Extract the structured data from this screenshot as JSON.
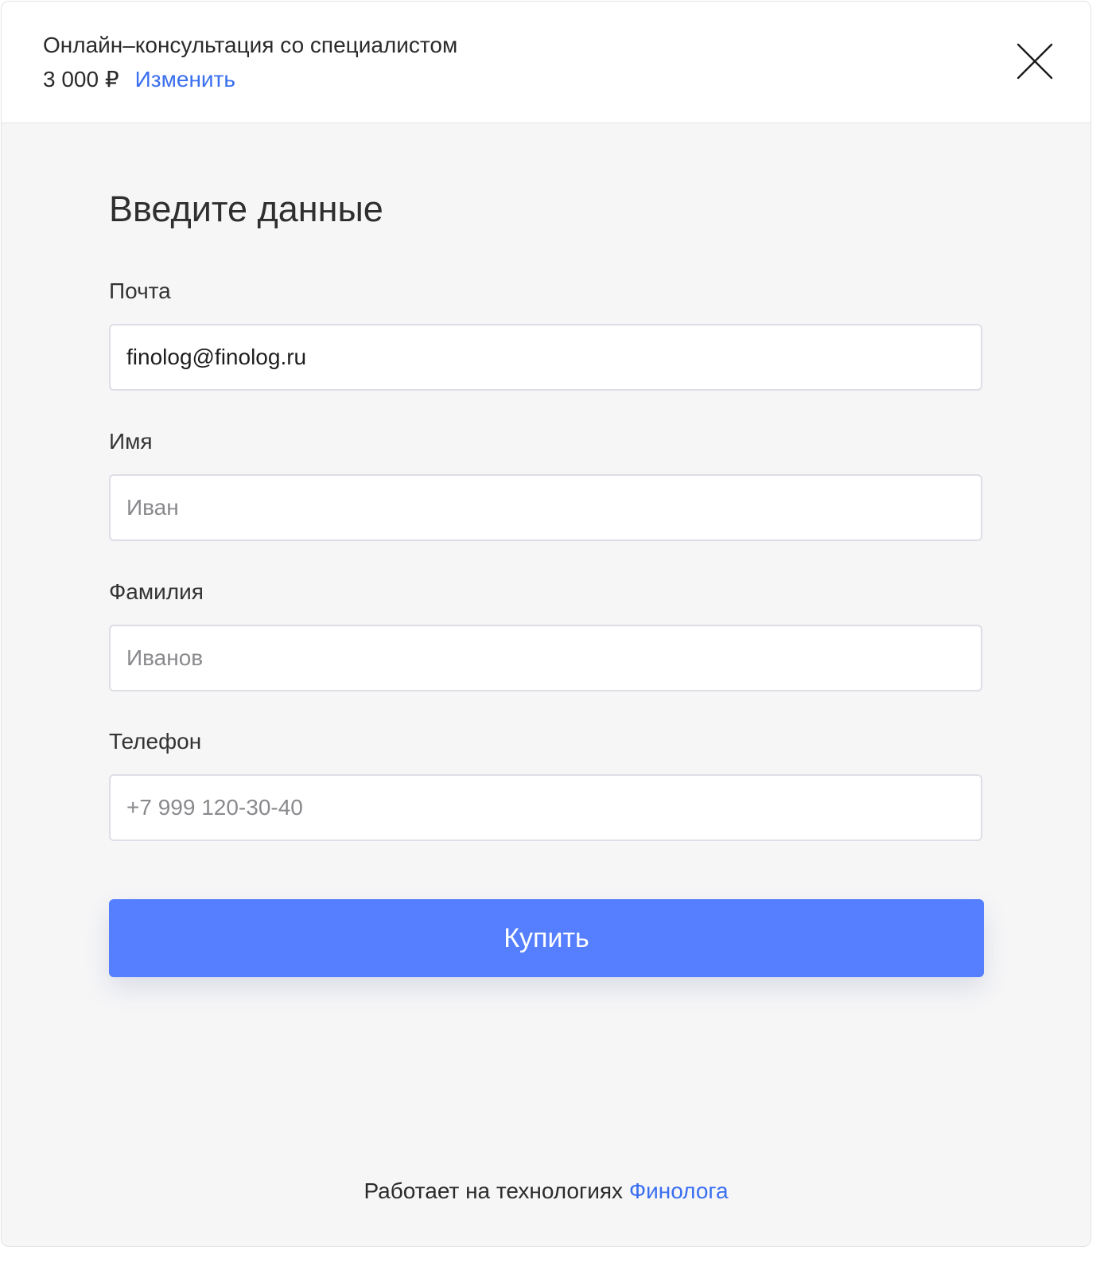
{
  "header": {
    "product_title": "Онлайн–консультация со специалистом",
    "price": "3 000 ₽",
    "change_link": "Изменить",
    "close_icon": "close-icon"
  },
  "form": {
    "title": "Введите данные",
    "fields": {
      "email": {
        "label": "Почта",
        "value": "finolog@finolog.ru",
        "placeholder": ""
      },
      "first_name": {
        "label": "Имя",
        "value": "",
        "placeholder": "Иван"
      },
      "last_name": {
        "label": "Фамилия",
        "value": "",
        "placeholder": "Иванов"
      },
      "phone": {
        "label": "Телефон",
        "value": "",
        "placeholder": "+7 999 120-30-40"
      }
    },
    "buy_button": "Купить"
  },
  "footer": {
    "text": "Работает на технологиях",
    "link": "Финолога"
  },
  "colors": {
    "accent": "#557ffe",
    "link": "#3a6ff0",
    "background": "#f6f6f7",
    "header_background": "#ffffff"
  }
}
